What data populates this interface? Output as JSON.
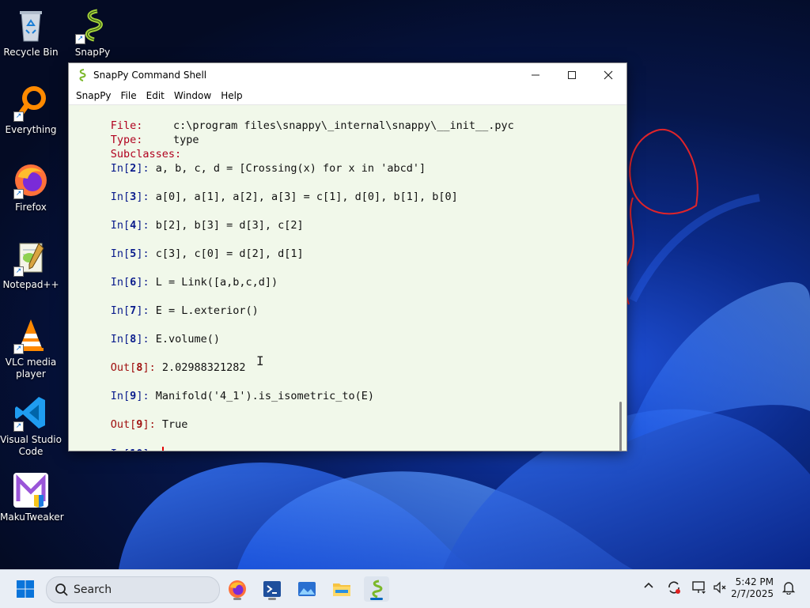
{
  "desktop": {
    "icons": [
      {
        "label": "Recycle Bin",
        "icon": "recycle-bin-icon"
      },
      {
        "label": "SnapPy",
        "icon": "snappy-icon"
      },
      {
        "label": "Everything",
        "icon": "everything-icon"
      },
      {
        "label": "Firefox",
        "icon": "firefox-icon"
      },
      {
        "label": "Notepad++",
        "icon": "notepadpp-icon"
      },
      {
        "label": "VLC media player",
        "icon": "vlc-icon"
      },
      {
        "label": "Visual Studio Code",
        "icon": "vscode-icon"
      },
      {
        "label": "MakuTweaker",
        "icon": "makutweaker-icon"
      }
    ]
  },
  "window": {
    "title": "SnapPy Command Shell",
    "menu": [
      "SnapPy",
      "File",
      "Edit",
      "Window",
      "Help"
    ],
    "console": {
      "info": [
        {
          "key": "File:",
          "value": "c:\\program files\\snappy\\_internal\\snappy\\__init__.pyc"
        },
        {
          "key": "Type:",
          "value": "type"
        },
        {
          "key": "Subclasses:",
          "value": ""
        }
      ],
      "entries": [
        {
          "kind": "in",
          "num": "2",
          "code": "a, b, c, d = [Crossing(x) for x in 'abcd']"
        },
        {
          "kind": "in",
          "num": "3",
          "code": "a[0], a[1], a[2], a[3] = c[1], d[0], b[1], b[0]"
        },
        {
          "kind": "in",
          "num": "4",
          "code": "b[2], b[3] = d[3], c[2]"
        },
        {
          "kind": "in",
          "num": "5",
          "code": "c[3], c[0] = d[2], d[1]"
        },
        {
          "kind": "in",
          "num": "6",
          "code": "L = Link([a,b,c,d])"
        },
        {
          "kind": "in",
          "num": "7",
          "code": "E = L.exterior()"
        },
        {
          "kind": "in",
          "num": "8",
          "code": "E.volume()"
        },
        {
          "kind": "out",
          "num": "8",
          "code": "2.02988321282"
        },
        {
          "kind": "in",
          "num": "9",
          "code": "Manifold('4_1').is_isometric_to(E)"
        },
        {
          "kind": "out",
          "num": "9",
          "code": "True"
        },
        {
          "kind": "in",
          "num": "10",
          "code": ""
        }
      ]
    }
  },
  "taskbar": {
    "search_label": "Search",
    "time": "5:42 PM",
    "date": "2/7/2025"
  },
  "colors": {
    "console_bg": "#f1f8ea",
    "prompt_in": "#0a1c8c",
    "prompt_out": "#a01010",
    "info_key": "#b0001e",
    "caret": "#e00000"
  }
}
